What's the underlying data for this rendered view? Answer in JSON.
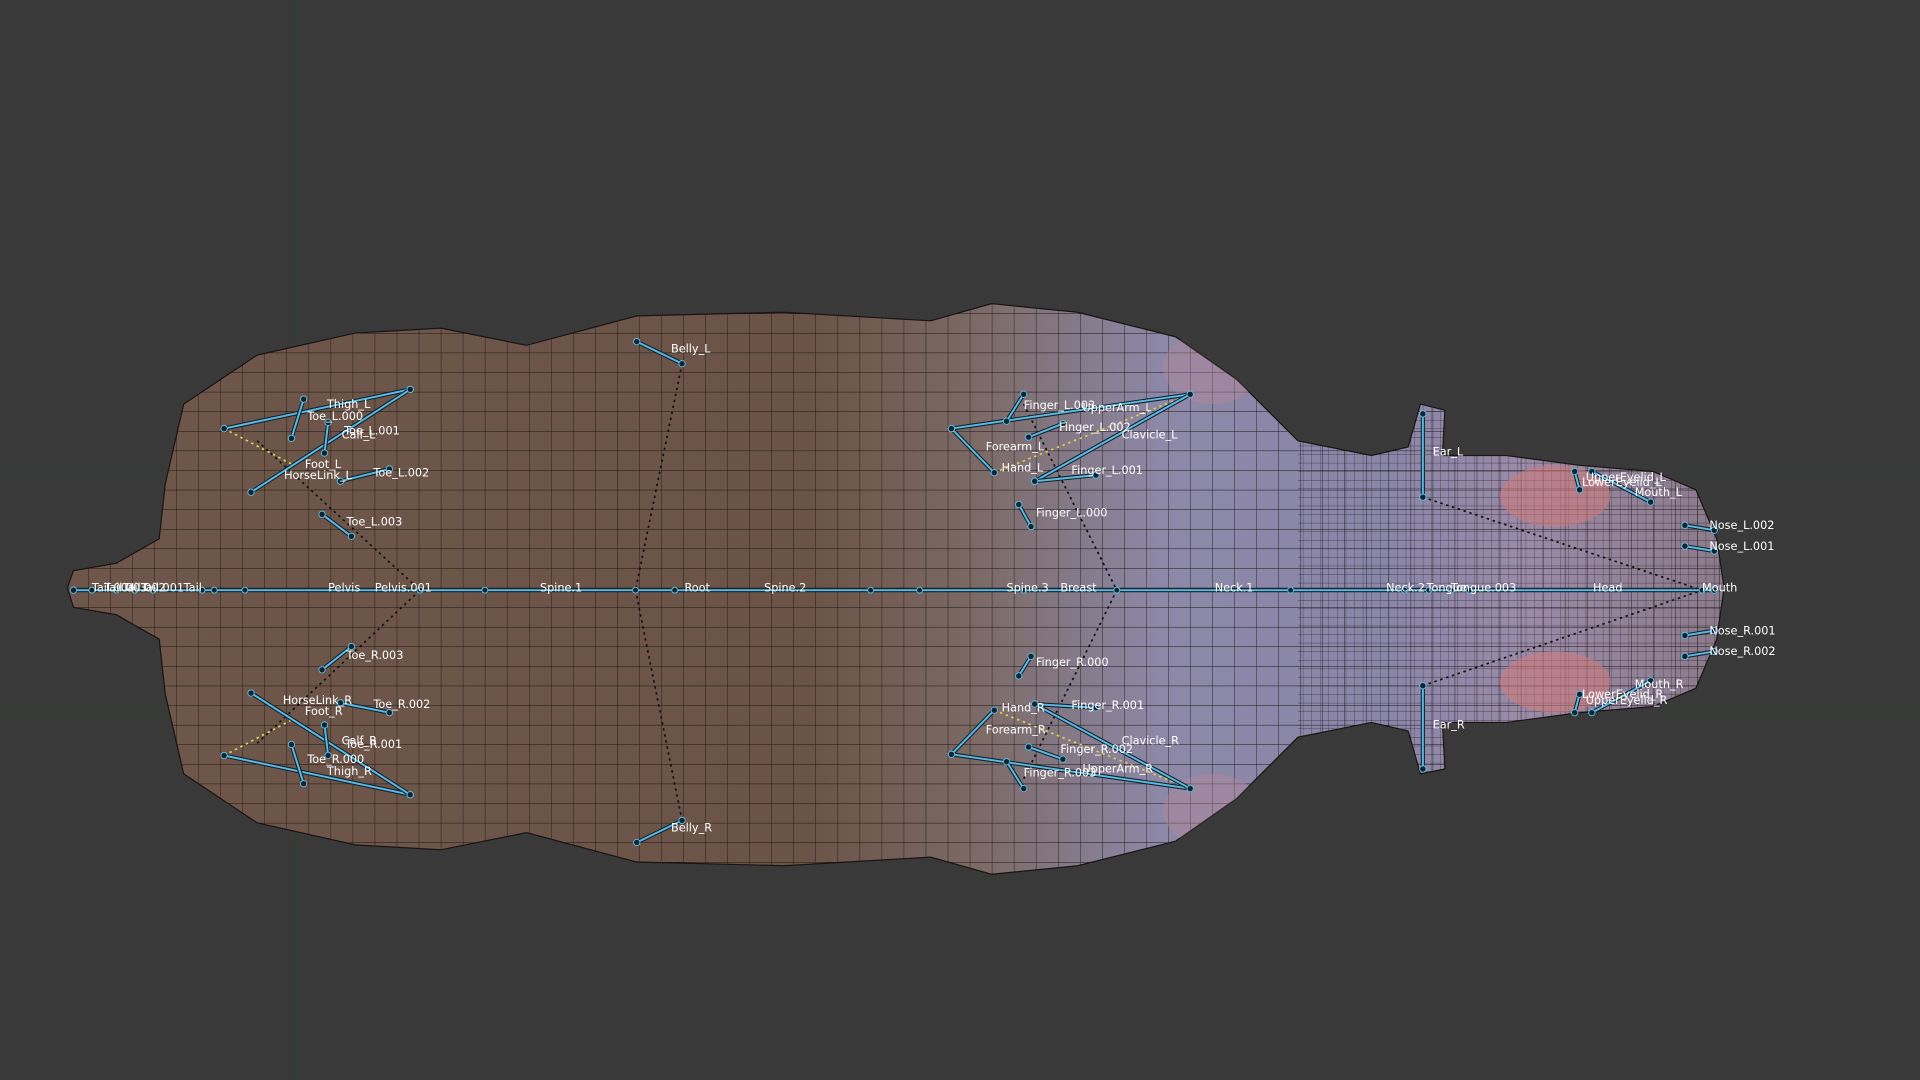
{
  "viewport": {
    "background": "#393939",
    "grid_color": "#2f4a2f",
    "bone_color": "#5fb8e0",
    "body_colors": {
      "hide": "#6b5346",
      "front": "#8a86a6",
      "lips": "#c77876"
    }
  },
  "labels": {
    "belly_l": "Belly_L",
    "thigh_l": "Thigh_L",
    "toe_l_000": "Toe_L.000",
    "toe_l_001": "Toe_L.001",
    "calf_l": "Calf_L",
    "foot_l": "Foot_L",
    "horselink_l": "HorseLink_L",
    "toe_l_002": "Toe_L.002",
    "toe_l_003": "Toe_L.003",
    "tail_004": "Tail.004",
    "tail_003": "Tail.003",
    "tail_002": "Tail.002",
    "tail_001": "Tail.001",
    "tail": "Tail",
    "pelvis": "Pelvis",
    "pelvis_001": "Pelvis.001",
    "spine_1": "Spine.1",
    "root": "Root",
    "spine_2": "Spine.2",
    "spine_3": "Spine.3",
    "breast": "Breast",
    "neck_1": "Neck.1",
    "neck_2": "Neck.2",
    "tongue": "Tongue",
    "tongue_003": "Tongue.003",
    "head": "Head",
    "mouth": "Mouth",
    "finger_l_003": "Finger_L.003",
    "upperarm_l": "UpperArm_L",
    "finger_l_002": "Finger_L.002",
    "clavicle_l": "Clavicle_L",
    "forearm_l": "Forearm_L",
    "hand_l": "Hand_L",
    "finger_l_001": "Finger_L.001",
    "finger_l_000": "Finger_L.000",
    "ear_l": "Ear_L",
    "uppereyelid_l": "UpperEyelid_L",
    "lowereyelid_l": "LowerEyelid_L",
    "mouth_l": "Mouth_L",
    "nose_l_002": "Nose_L.002",
    "nose_l_001": "Nose_L.001",
    "nose_r_001": "Nose_R.001",
    "nose_r_002": "Nose_R.002",
    "mouth_r": "Mouth_R",
    "lowereyelid_r": "LowerEyelid_R",
    "uppereyelid_r": "UpperEyelid_R",
    "ear_r": "Ear_R",
    "finger_r_000": "Finger_R.000",
    "hand_r": "Hand_R",
    "finger_r_001": "Finger_R.001",
    "forearm_r": "Forearm_R",
    "finger_r_002": "Finger_R.002",
    "clavicle_r": "Clavicle_R",
    "finger_r_003": "Finger_R.003",
    "upperarm_r": "UpperArm_R",
    "toe_r_003": "Toe_R.003",
    "horselink_r": "HorseLink_R",
    "foot_r": "Foot_R",
    "toe_r_002": "Toe_R.002",
    "calf_r": "Calf_R",
    "toe_r_001": "Toe_R.001",
    "toe_r_000": "Toe_R.000",
    "thigh_r": "Thigh_R",
    "belly_r": "Belly_R"
  }
}
